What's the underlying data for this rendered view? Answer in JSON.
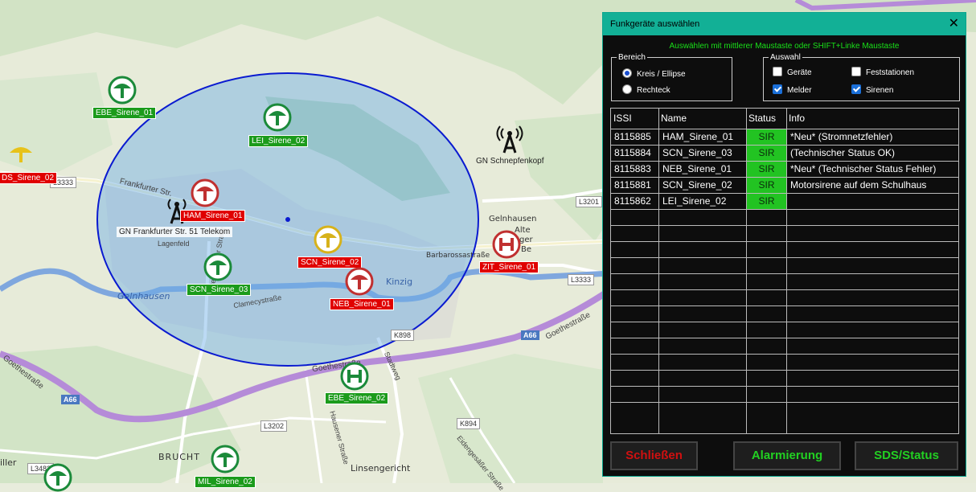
{
  "map": {
    "places": {
      "gelnhausen_river": "Gelnhausen",
      "gelnhausen_town": "Gelnhausen",
      "alte": "Alte",
      "ger": "ger",
      "be": "Be",
      "kinzig": "Kinzig",
      "barbarossa": "Barbarossastraße",
      "goethe1": "Goethestraße",
      "goethe2": "Goethestraße",
      "goethe3": "Goethestraße",
      "frankfurter": "Frankfurter Str.",
      "clamecy": "Clamecystraße",
      "freigericht": "Freigerichter Straße",
      "brucht": "BRUCHT",
      "linsengericht": "Linsengericht",
      "eidengesaess": "Eidengesäßer Straße",
      "hausen": "Hausener Straße",
      "stadtweg": "Stadtweg",
      "lagenfeld": "Lagenfeld",
      "lle": "iller"
    },
    "roads": [
      "L3333",
      "L3201",
      "L3333",
      "K898",
      "L3202",
      "K894",
      "L3483"
    ],
    "autobahn": [
      "A66",
      "A66"
    ],
    "markers": [
      {
        "label": "EBE_Sirene_01",
        "type": "green"
      },
      {
        "label": "LEI_Sirene_02",
        "type": "green"
      },
      {
        "label": "DS_Sirene_02",
        "type": "red"
      },
      {
        "label": "HAM_Sirene_01",
        "type": "red"
      },
      {
        "label": "SCN_Sirene_03",
        "type": "green"
      },
      {
        "label": "SCN_Sirene_02",
        "type": "red"
      },
      {
        "label": "NEB_Sirene_01",
        "type": "red"
      },
      {
        "label": "ZIT_Sirene_01",
        "type": "red"
      },
      {
        "label": "EBE_Sirene_02",
        "type": "green"
      },
      {
        "label": "MIL_Sirene_02",
        "type": "green"
      }
    ],
    "stations": [
      {
        "label": "GN Schnepfenkopf"
      },
      {
        "label": "GN Frankfurter Str. 51 Telekom"
      }
    ]
  },
  "dialog": {
    "title": "Funkgeräte auswählen",
    "close": "✕",
    "hint": "Auswählen mit mittlerer Maustaste oder  SHIFT+Linke Maustaste",
    "bereich": {
      "legend": "Bereich",
      "options": [
        {
          "label": "Kreis / Ellipse",
          "selected": true
        },
        {
          "label": "Rechteck",
          "selected": false
        }
      ]
    },
    "auswahl": {
      "legend": "Auswahl",
      "options": [
        {
          "label": "Geräte",
          "checked": false
        },
        {
          "label": "Feststationen",
          "checked": false
        },
        {
          "label": "Melder",
          "checked": true
        },
        {
          "label": "Sirenen",
          "checked": true
        }
      ]
    },
    "table": {
      "columns": [
        "ISSI",
        "Name",
        "Status",
        "Info"
      ],
      "rows": [
        {
          "issi": "8115885",
          "name": "HAM_Sirene_01",
          "status": "SIR",
          "info": "*Neu* (Stromnetzfehler)"
        },
        {
          "issi": "8115884",
          "name": "SCN_Sirene_03",
          "status": "SIR",
          "info": "(Technischer Status OK)"
        },
        {
          "issi": "8115883",
          "name": "NEB_Sirene_01",
          "status": "SIR",
          "info": "*Neu* (Technischer Status Fehler)"
        },
        {
          "issi": "8115881",
          "name": "SCN_Sirene_02",
          "status": "SIR",
          "info": "Motorsirene auf dem Schulhaus"
        },
        {
          "issi": "8115862",
          "name": "LEI_Sirene_02",
          "status": "SIR",
          "info": ""
        }
      ],
      "empty_rows": 13
    },
    "buttons": {
      "close": "Schließen",
      "alarm": "Alarmierung",
      "sds": "SDS/Status"
    },
    "colors": {
      "accent": "#12b096",
      "hint": "#19e019",
      "status_green": "#22c322",
      "close_text": "#d01010",
      "action_text": "#22d022"
    }
  }
}
